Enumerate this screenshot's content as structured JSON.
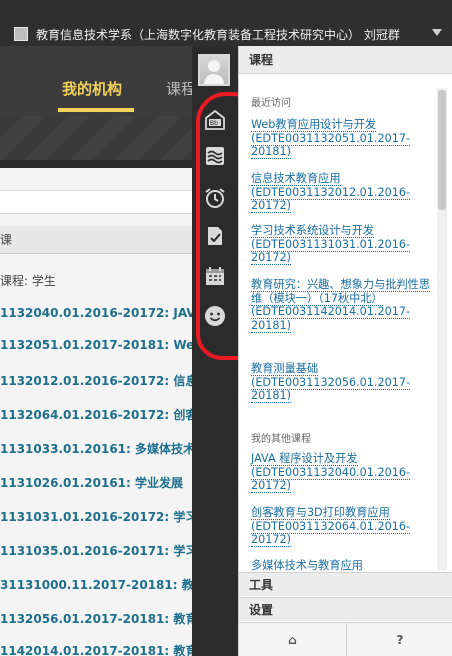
{
  "topbar": {
    "user_text": "教育信息技术学系（上海数字化教育装备工程技术研究中心） 刘冠群"
  },
  "header": {
    "my_org_tab": "我的机构",
    "second_tab": "课程"
  },
  "content": {
    "section_cut": "课",
    "role_line": "课程: 学生",
    "course_rows": [
      "1132040.01.2016-20172: JAV",
      "1132051.01.2017-20181: We",
      "1132012.01.2016-20172: 信息",
      "1132064.01.2016-20172: 创客",
      "1131033.01.20161: 多媒体技术",
      "1131026.01.20161: 学业发展",
      "1131031.01.2016-20172: 学习",
      "1131035.01.2016-20171: 学习",
      "31131000.11.2017-20181: 教育",
      "1132056.01.2017-20181: 教育",
      "1142014.01.2017-20181: 教育研究：兴趣、想象力与批判性"
    ]
  },
  "side_icons": [
    "blackboard-icon",
    "waves-icon",
    "alarm-clock-icon",
    "document-check-icon",
    "calendar-icon",
    "smiley-icon"
  ],
  "panel": {
    "title": "课程",
    "recent_label": "最近访问",
    "recent": [
      "Web教育应用设计与开发 (EDTE0031132051.01.2017-20181)",
      "信息技术教育应用 (EDTE0031132012.01.2016-20172)",
      "学习技术系统设计与开发 (EDTE0031131031.01.2016-20172)",
      "教育研究：兴趣、想象力与批判性思维（模块一）（17秋中北） (EDTE0031142014.01.2017-20181)",
      "教育测量基础 (EDTE0031132056.01.2017-20181)"
    ],
    "other_label": "我的其他课程",
    "other": [
      "JAVA 程序设计及开发 (EDTE0031132040.01.2016-20172)",
      "创客教育与3D打印教育应用 (EDTE0031132064.01.2016-20172)",
      "多媒体技术与教育应用"
    ],
    "tools_label": "工具",
    "settings_label": "设置",
    "home_button": "⌂",
    "help_button": "?"
  },
  "colors": {
    "annotation": "#ea1a22",
    "link": "#1a6fa0",
    "org_tab": "#f2d15a"
  }
}
